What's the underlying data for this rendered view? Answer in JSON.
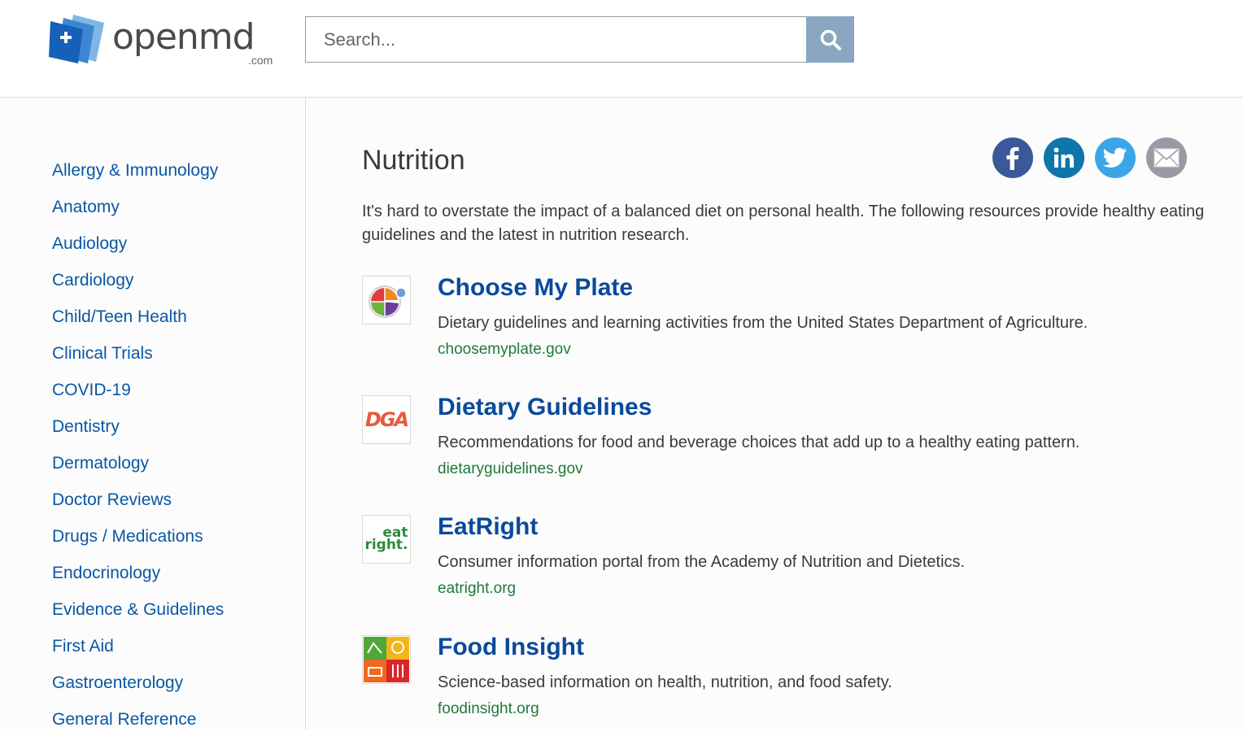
{
  "header": {
    "logo_text": "openmd",
    "logo_tld": ".com",
    "search_placeholder": "Search...",
    "search_icon": "search-icon"
  },
  "sidebar": {
    "items": [
      {
        "label": "Allergy & Immunology"
      },
      {
        "label": "Anatomy"
      },
      {
        "label": "Audiology"
      },
      {
        "label": "Cardiology"
      },
      {
        "label": "Child/Teen Health"
      },
      {
        "label": "Clinical Trials"
      },
      {
        "label": "COVID-19"
      },
      {
        "label": "Dentistry"
      },
      {
        "label": "Dermatology"
      },
      {
        "label": "Doctor Reviews"
      },
      {
        "label": "Drugs / Medications"
      },
      {
        "label": "Endocrinology"
      },
      {
        "label": "Evidence & Guidelines"
      },
      {
        "label": "First Aid"
      },
      {
        "label": "Gastroenterology"
      },
      {
        "label": "General Reference"
      }
    ]
  },
  "main": {
    "title": "Nutrition",
    "intro": "It's hard to overstate the impact of a balanced diet on personal health. The following resources provide healthy eating guidelines and the latest in nutrition research.",
    "share": [
      {
        "icon": "facebook-icon",
        "color": "#3b5998"
      },
      {
        "icon": "linkedin-icon",
        "color": "#0e76a8"
      },
      {
        "icon": "twitter-icon",
        "color": "#3aa6e8"
      },
      {
        "icon": "email-icon",
        "color": "#9a9aa6"
      }
    ],
    "resources": [
      {
        "title": "Choose My Plate",
        "description": "Dietary guidelines and learning activities from the United States Department of Agriculture.",
        "url": "choosemyplate.gov",
        "thumb_icon": "myplate-logo-icon"
      },
      {
        "title": "Dietary Guidelines",
        "description": "Recommendations for food and beverage choices that add up to a healthy eating pattern.",
        "url": "dietaryguidelines.gov",
        "thumb_icon": "dga-logo-icon",
        "thumb_text": "DGA"
      },
      {
        "title": "EatRight",
        "description": "Consumer information portal from the Academy of Nutrition and Dietetics.",
        "url": "eatright.org",
        "thumb_icon": "eatright-logo-icon",
        "thumb_text_top": "eat",
        "thumb_text_bottom": "right."
      },
      {
        "title": "Food Insight",
        "description": "Science-based information on health, nutrition, and food safety.",
        "url": "foodinsight.org",
        "thumb_icon": "foodinsight-logo-icon"
      }
    ]
  },
  "colors": {
    "link_blue": "#0a57a4",
    "title_blue": "#0a4a9c",
    "url_green": "#1f7a3a",
    "search_button": "#8aa6c0"
  }
}
